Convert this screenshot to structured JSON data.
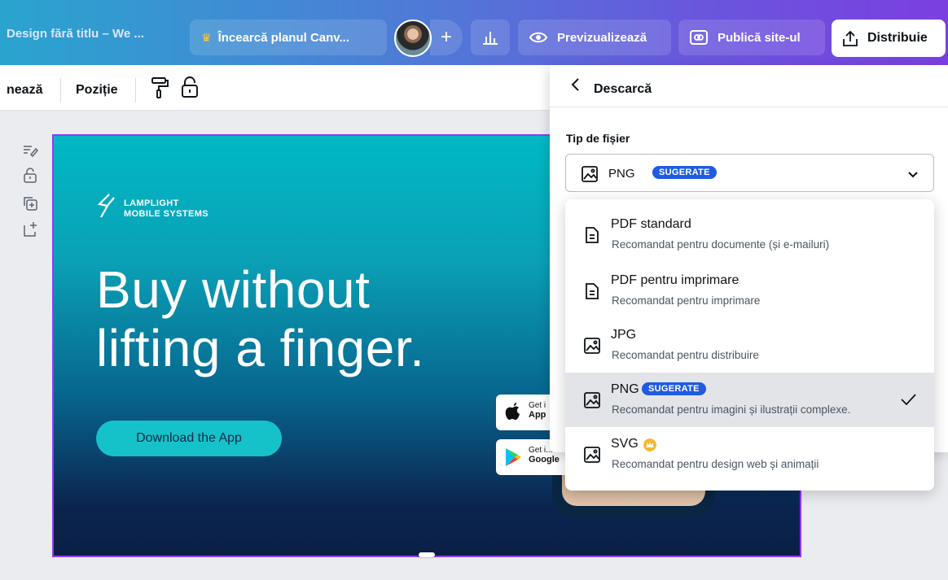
{
  "topbar": {
    "doc_title": "Design fără titlu – We ...",
    "try_plan_label": "Încearcă planul Canv...",
    "plus_label": "+",
    "preview_label": "Previzualizează",
    "publish_label": "Publică site-ul",
    "share_label": "Distribuie"
  },
  "toolbar": {
    "animate_label": "nează",
    "position_label": "Poziție"
  },
  "design": {
    "logo_line1": "LAMPLIGHT",
    "logo_line2": "MOBILE SYSTEMS",
    "headline_line1": "Buy without",
    "headline_line2": "lifting a finger.",
    "cta_label": "Download the App",
    "appstore_small": "Get i",
    "appstore_big": "App",
    "googleplay_small": "Get i...",
    "googleplay_big": "Google"
  },
  "panel": {
    "title": "Descarcă",
    "file_type_label": "Tip de fișier",
    "selected_value": "PNG",
    "selected_badge": "SUGERATE"
  },
  "dropdown": {
    "options": [
      {
        "title": "PDF standard",
        "desc": "Recomandat pentru documente (și e-mailuri)",
        "icon": "document-icon"
      },
      {
        "title": "PDF pentru imprimare",
        "desc": "Recomandat pentru imprimare",
        "icon": "document-icon"
      },
      {
        "title": "JPG",
        "desc": "Recomandat pentru distribuire",
        "icon": "image-icon"
      },
      {
        "title": "PNG",
        "desc": "Recomandat pentru imagini și ilustrații complexe.",
        "icon": "image-icon",
        "badge": "SUGERATE",
        "selected": true
      },
      {
        "title": "SVG",
        "desc": "Recomandat pentru design web și animații",
        "icon": "image-icon",
        "premium": true
      }
    ]
  },
  "colors": {
    "accent": "#8b3dff",
    "badge": "#1f5ce0",
    "crown": "#f5b82e"
  }
}
